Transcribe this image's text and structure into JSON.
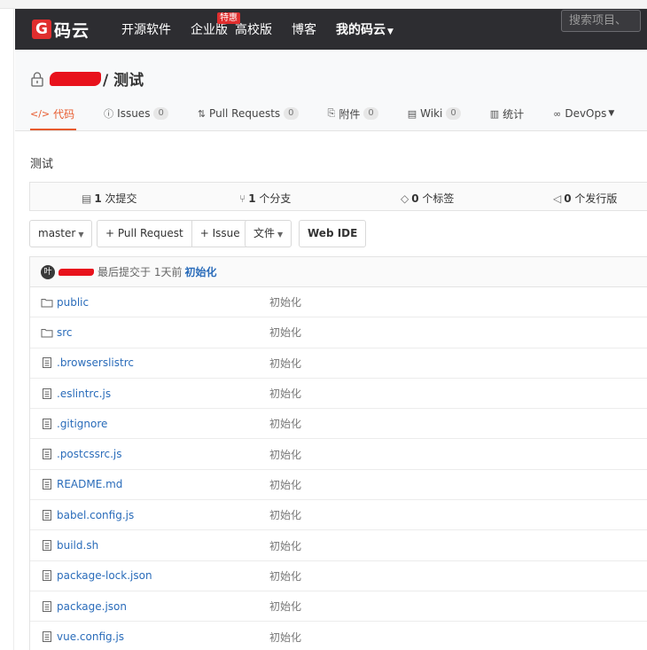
{
  "topnav": {
    "logo_mark": "G",
    "logo_text": "码云",
    "items": [
      {
        "label": "开源软件"
      },
      {
        "label": "企业版",
        "badge": "特惠"
      },
      {
        "label": "高校版"
      },
      {
        "label": "博客"
      },
      {
        "label": "我的码云"
      }
    ],
    "search_placeholder": "搜索项目、"
  },
  "repo": {
    "name": "/ 测试"
  },
  "tabs": [
    {
      "label": "代码",
      "icon": "code-icon"
    },
    {
      "label": "Issues",
      "count": "0",
      "icon": "issue-icon"
    },
    {
      "label": "Pull Requests",
      "count": "0",
      "icon": "pull-request-icon"
    },
    {
      "label": "附件",
      "count": "0",
      "icon": "paperclip-icon"
    },
    {
      "label": "Wiki",
      "count": "0",
      "icon": "book-icon"
    },
    {
      "label": "统计",
      "icon": "chart-icon"
    },
    {
      "label": "DevOps",
      "icon": "infinity-icon"
    }
  ],
  "description": "测试",
  "stats": {
    "commits_num": "1",
    "commits_label": "次提交",
    "branches_num": "1",
    "branches_label": "个分支",
    "tags_num": "0",
    "tags_label": "个标签",
    "releases_num": "0",
    "releases_label": "个发行版"
  },
  "actions": {
    "branch": "master",
    "pull_request": "+ Pull Request",
    "issue": "+ Issue",
    "files": "文件",
    "web_ide": "Web IDE"
  },
  "last_commit": {
    "avatar_text": "叶",
    "prefix": "最后提交于 1天前",
    "message": "初始化"
  },
  "files": [
    {
      "name": "public",
      "type": "folder",
      "message": "初始化"
    },
    {
      "name": "src",
      "type": "folder",
      "message": "初始化"
    },
    {
      "name": ".browserslistrc",
      "type": "file",
      "message": "初始化"
    },
    {
      "name": ".eslintrc.js",
      "type": "file",
      "message": "初始化"
    },
    {
      "name": ".gitignore",
      "type": "file",
      "message": "初始化"
    },
    {
      "name": ".postcssrc.js",
      "type": "file",
      "message": "初始化"
    },
    {
      "name": "README.md",
      "type": "file",
      "message": "初始化"
    },
    {
      "name": "babel.config.js",
      "type": "file",
      "message": "初始化"
    },
    {
      "name": "build.sh",
      "type": "file",
      "message": "初始化"
    },
    {
      "name": "package-lock.json",
      "type": "file",
      "message": "初始化"
    },
    {
      "name": "package.json",
      "type": "file",
      "message": "初始化"
    },
    {
      "name": "vue.config.js",
      "type": "file",
      "message": "初始化"
    }
  ],
  "colors": {
    "nav_bg": "#2d2d31",
    "accent": "#e75a2d",
    "brand_red": "#e02e2e",
    "link": "#2a6cba"
  }
}
